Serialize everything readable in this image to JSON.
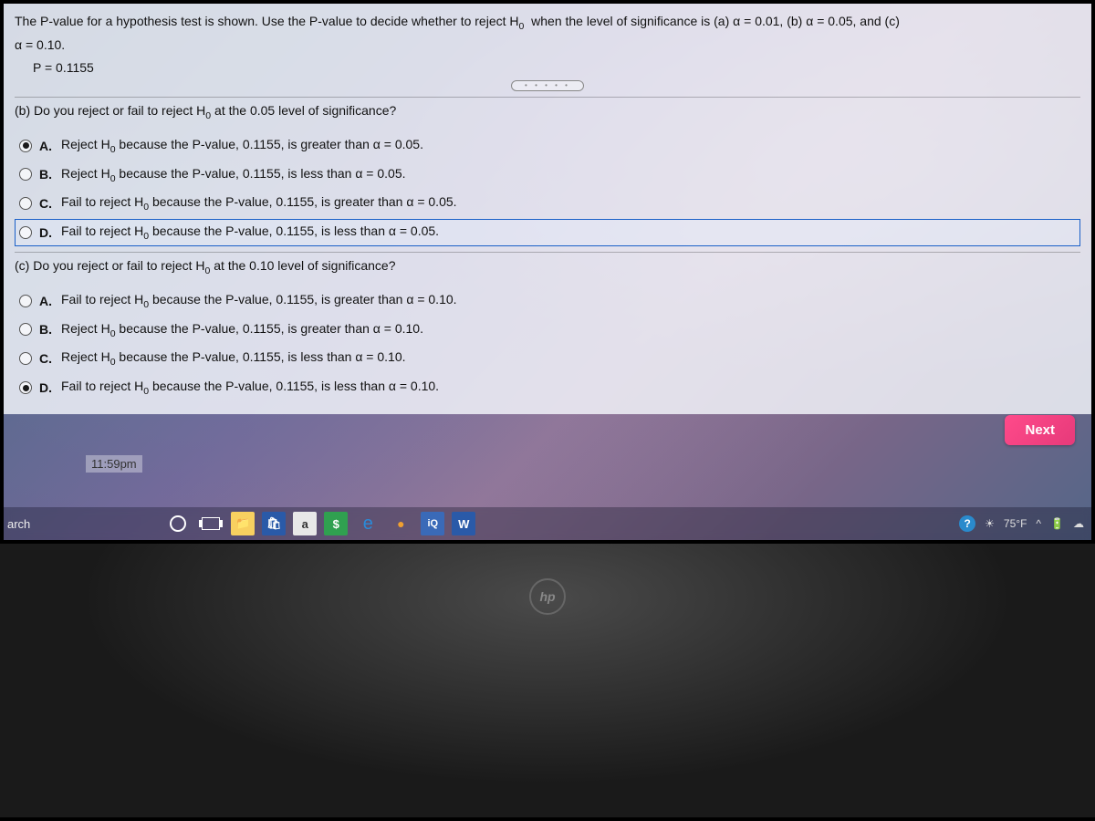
{
  "intro_line1": "The P-value for a hypothesis test is shown. Use the P-value to decide whether to reject H",
  "intro_sub0": "0",
  "intro_line1b": " when the level of significance is (a) α = 0.01, (b) α = 0.05, and (c)",
  "intro_line2": "α = 0.10.",
  "p_value_line": "P = 0.1155",
  "dots": "• • • • •",
  "part_b": {
    "question_pre": "(b) Do you reject or fail to reject H",
    "question_sub": "0",
    "question_post": " at the 0.05 level of significance?",
    "options": [
      {
        "letter": "A.",
        "pre": "Reject H",
        "post": " because the P-value, 0.1155, is greater than α = 0.05.",
        "selected": true,
        "highlighted": false
      },
      {
        "letter": "B.",
        "pre": "Reject H",
        "post": " because the P-value, 0.1155, is less than α = 0.05.",
        "selected": false,
        "highlighted": false
      },
      {
        "letter": "C.",
        "pre": "Fail to reject H",
        "post": " because the P-value, 0.1155, is greater than α = 0.05.",
        "selected": false,
        "highlighted": false
      },
      {
        "letter": "D.",
        "pre": "Fail to reject H",
        "post": " because the P-value, 0.1155, is less than α = 0.05.",
        "selected": false,
        "highlighted": true
      }
    ]
  },
  "part_c": {
    "question_pre": "(c) Do you reject or fail to reject H",
    "question_sub": "0",
    "question_post": " at the 0.10 level of significance?",
    "options": [
      {
        "letter": "A.",
        "pre": "Fail to reject H",
        "post": " because the P-value, 0.1155, is greater than α = 0.10.",
        "selected": false
      },
      {
        "letter": "B.",
        "pre": "Reject H",
        "post": " because the P-value, 0.1155, is greater than α = 0.10.",
        "selected": false
      },
      {
        "letter": "C.",
        "pre": "Reject H",
        "post": " because the P-value, 0.1155, is less than α = 0.10.",
        "selected": false
      },
      {
        "letter": "D.",
        "pre": "Fail to reject H",
        "post": " because the P-value, 0.1155, is less than α = 0.10.",
        "selected": true
      }
    ]
  },
  "next_label": "Next",
  "deadline": "11:59pm",
  "taskbar": {
    "search": "arch",
    "apps": {
      "a_label": "a",
      "s_label": "$",
      "iq_label": "iQ",
      "w_label": "W"
    },
    "help": "?",
    "temp": "75°F",
    "caret": "^"
  },
  "hp": "hp"
}
